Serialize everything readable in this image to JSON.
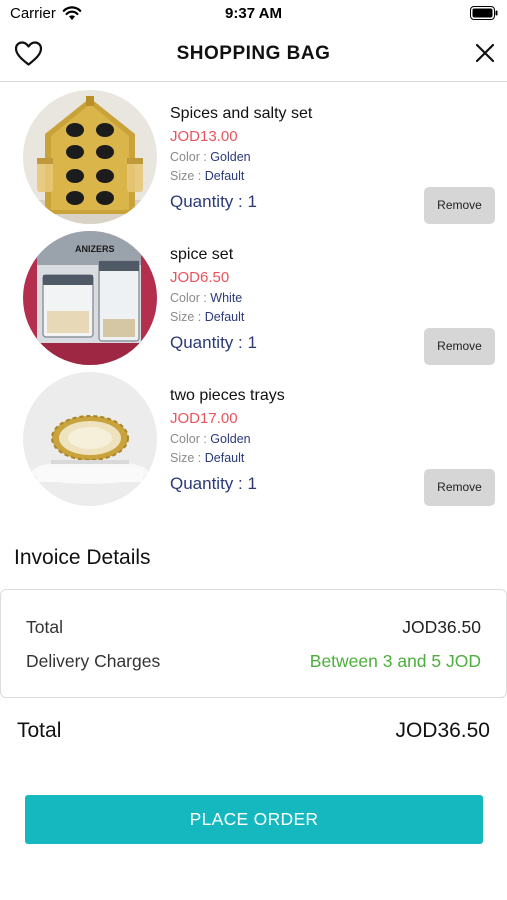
{
  "status_bar": {
    "carrier": "Carrier",
    "time": "9:37 AM"
  },
  "header": {
    "title": "SHOPPING BAG"
  },
  "items": [
    {
      "name": "Spices and salty set",
      "price": "JOD13.00",
      "color_label": "Color : ",
      "color_value": "Golden",
      "size_label": "Size : ",
      "size_value": "Default",
      "quantity": "Quantity : 1",
      "remove_label": "Remove"
    },
    {
      "name": "spice set",
      "price": "JOD6.50",
      "color_label": "Color : ",
      "color_value": "White",
      "size_label": "Size : ",
      "size_value": "Default",
      "quantity": "Quantity : 1",
      "remove_label": "Remove",
      "image_text": "ANIZERS"
    },
    {
      "name": "two pieces trays",
      "price": "JOD17.00",
      "color_label": "Color : ",
      "color_value": "Golden",
      "size_label": "Size : ",
      "size_value": "Default",
      "quantity": "Quantity : 1",
      "remove_label": "Remove"
    }
  ],
  "invoice": {
    "heading": "Invoice Details",
    "total_label": "Total",
    "total_value": "JOD36.50",
    "delivery_label": "Delivery Charges",
    "delivery_value": "Between 3 and 5 JOD"
  },
  "summary": {
    "total_label": "Total",
    "total_value": "JOD36.50"
  },
  "actions": {
    "place_order_label": "PLACE ORDER"
  },
  "colors": {
    "accent": "#16b8bf",
    "price": "#e8545e",
    "attribute_value": "#2b3a77",
    "delivery": "#4caf3b",
    "remove_button": "#d6d6d6"
  }
}
